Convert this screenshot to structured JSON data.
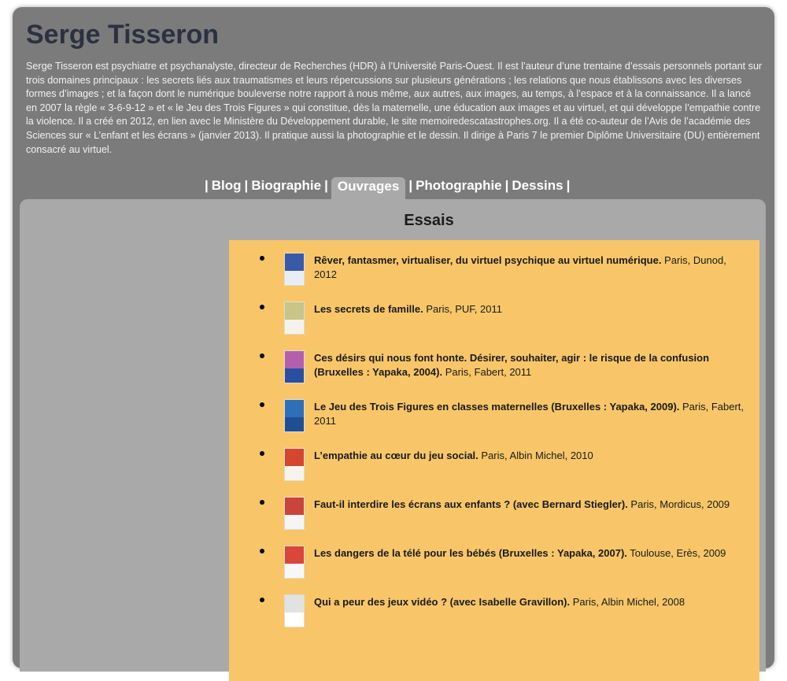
{
  "header": {
    "title": "Serge Tisseron",
    "intro": "Serge Tisseron est psychiatre et psychanalyste, directeur de Recherches (HDR) à l’Université Paris-Ouest. Il est l’auteur d’une trentaine d’essais personnels portant sur trois domaines principaux : les secrets liés aux traumatismes et leurs répercussions sur plusieurs générations ; les relations que nous établissons avec les diverses formes d’images ; et la façon dont le numérique bouleverse notre rapport à nous même, aux autres, aux images, au temps, à l’espace et à la connaissance. Il a lancé en 2007 la règle « 3-6-9-12 » et « le Jeu des Trois Figures » qui constitue, dès la maternelle, une éducation aux images et au virtuel, et qui développe l’empathie contre la violence. Il a créé en 2012, en lien avec le Ministère du Développement durable, le site memoiredescatastrophes.org. Il a été co-auteur de l’Avis de l’académie des Sciences sur « L’enfant et les écrans » (janvier 2013). Il pratique aussi la photographie et le dessin. Il dirige à Paris 7 le premier Diplôme Universitaire (DU) entièrement consacré au virtuel."
  },
  "nav": {
    "separator": "|",
    "items": [
      {
        "label": "Blog",
        "active": false
      },
      {
        "label": "Biographie",
        "active": false
      },
      {
        "label": "Ouvrages",
        "active": true
      },
      {
        "label": "Photographie",
        "active": false
      },
      {
        "label": "Dessins",
        "active": false
      }
    ]
  },
  "section": {
    "title": "Essais"
  },
  "books": [
    {
      "title": "Rêver, fantasmer, virtualiser, du virtuel psychique au virtuel numérique.",
      "details": " Paris, Dunod, 2012",
      "cover": [
        "#3a5aa8",
        "#e9eef6"
      ]
    },
    {
      "title": "Les secrets de famille.",
      "details": " Paris, PUF, 2011",
      "cover": [
        "#c8c48a",
        "#f4f2ea"
      ]
    },
    {
      "title": "Ces désirs qui nous font honte. Désirer, souhaiter, agir : le risque de la confusion (Bruxelles : Yapaka, 2004).",
      "details": " Paris, Fabert, 2011",
      "cover": [
        "#b35fae",
        "#2a4fa0"
      ]
    },
    {
      "title": "Le Jeu des Trois Figures en classes maternelles (Bruxelles : Yapaka, 2009).",
      "details": " Paris, Fabert, 2011",
      "cover": [
        "#2f6fb8",
        "#1e4f95"
      ]
    },
    {
      "title": "L’empathie au cœur du jeu social.",
      "details": " Paris, Albin Michel, 2010",
      "cover": [
        "#d6452f",
        "#f6f3ec"
      ]
    },
    {
      "title": "Faut-il interdire les écrans aux enfants ? (avec Bernard Stiegler).",
      "details": " Paris, Mordicus, 2009",
      "cover": [
        "#c9443c",
        "#f5f5f5"
      ]
    },
    {
      "title": "Les dangers de la télé pour les bébés (Bruxelles : Yapaka, 2007).",
      "details": " Toulouse, Erès, 2009",
      "cover": [
        "#d8473a",
        "#f7f7f7"
      ]
    },
    {
      "title": "Qui a peur des jeux vidéo ? (avec Isabelle Gravillon).",
      "details": " Paris, Albin Michel, 2008",
      "cover": [
        "#e2e2e2",
        "#ffffff"
      ]
    }
  ]
}
